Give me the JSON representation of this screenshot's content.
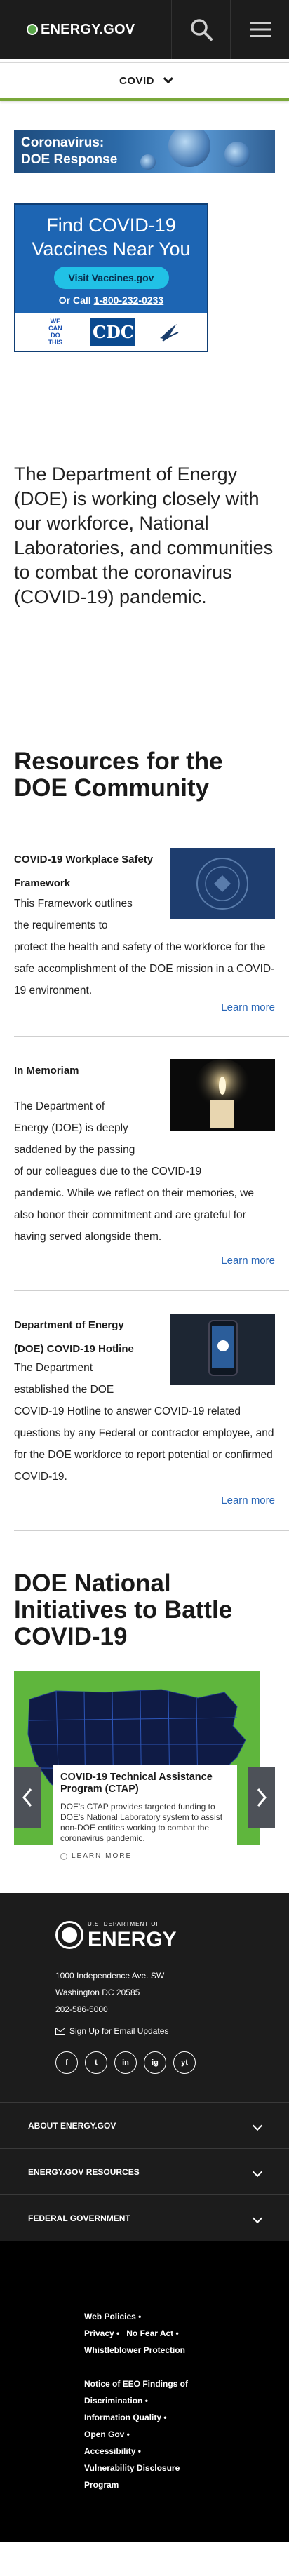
{
  "header": {
    "logo_text": "ENERGY.GOV",
    "icons": {
      "search": "search-icon",
      "menu": "menu-icon"
    }
  },
  "covid_nav": {
    "label": "COVID"
  },
  "banner": {
    "line1": "Coronavirus:",
    "line2": "DOE Response"
  },
  "vaccine_promo": {
    "title_line1": "Find COVID-19",
    "title_line2": "Vaccines Near You",
    "button_label": "Visit Vaccines.gov",
    "call_prefix": "Or Call ",
    "phone": "1-800-232-0233",
    "logos": {
      "wecan_line1": "WE",
      "wecan_line2": "CAN",
      "wecan_line3": "DO",
      "wecan_line4": "THIS",
      "cdc": "CDC"
    }
  },
  "intro_text": "The Department of Energy (DOE) is working closely with our workforce, National Laboratories, and communities to combat the coronavirus (COVID-19) pandemic.",
  "resources": {
    "heading": "Resources for the DOE Community",
    "items": [
      {
        "title_line1": "COVID-19 Workplace Safety",
        "title_line2": "Framework",
        "body_short1": "This Framework outlines",
        "body_short2": "the requirements to",
        "body_rest": "protect the health and safety of the workforce for the safe accomplishment of the DOE mission in a COVID-19 environment.",
        "learn_more": "Learn more"
      },
      {
        "title_line1": "In Memoriam",
        "title_line2": "",
        "body_short1": "The Department of",
        "body_short2": "Energy (DOE) is deeply",
        "body_short3": "saddened by the passing",
        "body_short4": "of our colleagues due to the COVID-19",
        "body_rest": "pandemic. While we reflect on their memories, we also honor their commitment and are grateful for having served alongside them.",
        "learn_more": "Learn more"
      },
      {
        "title_line1": "Department of Energy",
        "title_line2": "(DOE) COVID-19 Hotline",
        "body_short1": "The Department",
        "body_short2": "established the DOE",
        "body_rest": "COVID-19 Hotline to answer COVID-19 related questions by any Federal or contractor employee, and for the DOE workforce to report potential or confirmed COVID-19.",
        "learn_more": "Learn more"
      }
    ]
  },
  "initiatives": {
    "heading": "DOE National Initiatives to Battle COVID-19",
    "card_title": "COVID-19 Technical Assistance Program (CTAP)",
    "card_body": "DOE's CTAP provides targeted funding to DOE's National Laboratory system to assist non-DOE entities working to combat the coronavirus pandemic.",
    "card_learn": "LEARN MORE"
  },
  "footer": {
    "logo_small": "U.S. DEPARTMENT OF",
    "logo_big": "ENERGY",
    "address1": "1000 Independence Ave. SW",
    "address2": "Washington DC 20585",
    "phone": "202-586-5000",
    "signup": "Sign Up for Email Updates",
    "social": [
      "f",
      "t",
      "in",
      "ig",
      "yt"
    ],
    "accordion": [
      "ABOUT ENERGY.GOV",
      "ENERGY.GOV RESOURCES",
      "FEDERAL GOVERNMENT"
    ],
    "links_a": [
      "Web Policies",
      "Privacy",
      "No Fear Act",
      "Whistleblower Protection"
    ],
    "links_b": [
      "Notice of EEO Findings of",
      "Discrimination",
      "Information Quality",
      "Open Gov",
      "Accessibility",
      "Vulnerability Disclosure",
      "Program"
    ]
  }
}
